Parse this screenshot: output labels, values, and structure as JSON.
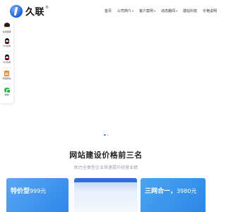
{
  "brand": {
    "name": "久联",
    "registered_mark": "®"
  },
  "nav": {
    "items": [
      {
        "label": "首页",
        "has_dropdown": false
      },
      {
        "label": "公司简介",
        "has_dropdown": true
      },
      {
        "label": "客户案例",
        "has_dropdown": true
      },
      {
        "label": "动态趣闻",
        "has_dropdown": true
      },
      {
        "label": "建站科技",
        "has_dropdown": false
      },
      {
        "label": "价格说明",
        "has_dropdown": false
      }
    ]
  },
  "sidebar": {
    "items": [
      {
        "label": "在线客服",
        "icon": "agent-avatar-icon"
      },
      {
        "label": "QQ咨询",
        "icon": "qq-icon"
      },
      {
        "label": "QQ咨询",
        "icon": "qq-icon"
      },
      {
        "label": "营销建站",
        "icon": "build-icon"
      },
      {
        "label": "微信",
        "icon": "wechat-icon"
      }
    ]
  },
  "banner": {
    "slide_count": 2,
    "active_index": 0
  },
  "section": {
    "title": "网站建设价格前三名",
    "subtitle": "助力全类型企业快速提升经营业绩"
  },
  "pricing_cards": [
    {
      "title": "特价型",
      "price": "999元"
    },
    {
      "title": "",
      "price": ""
    },
    {
      "title": "三网合一，",
      "price": "3980元"
    }
  ],
  "colors": {
    "accent": "#2e86e8",
    "card_blue": "#4aa6f2",
    "wechat_green": "#2db84d",
    "build_orange": "#f08a1a"
  }
}
